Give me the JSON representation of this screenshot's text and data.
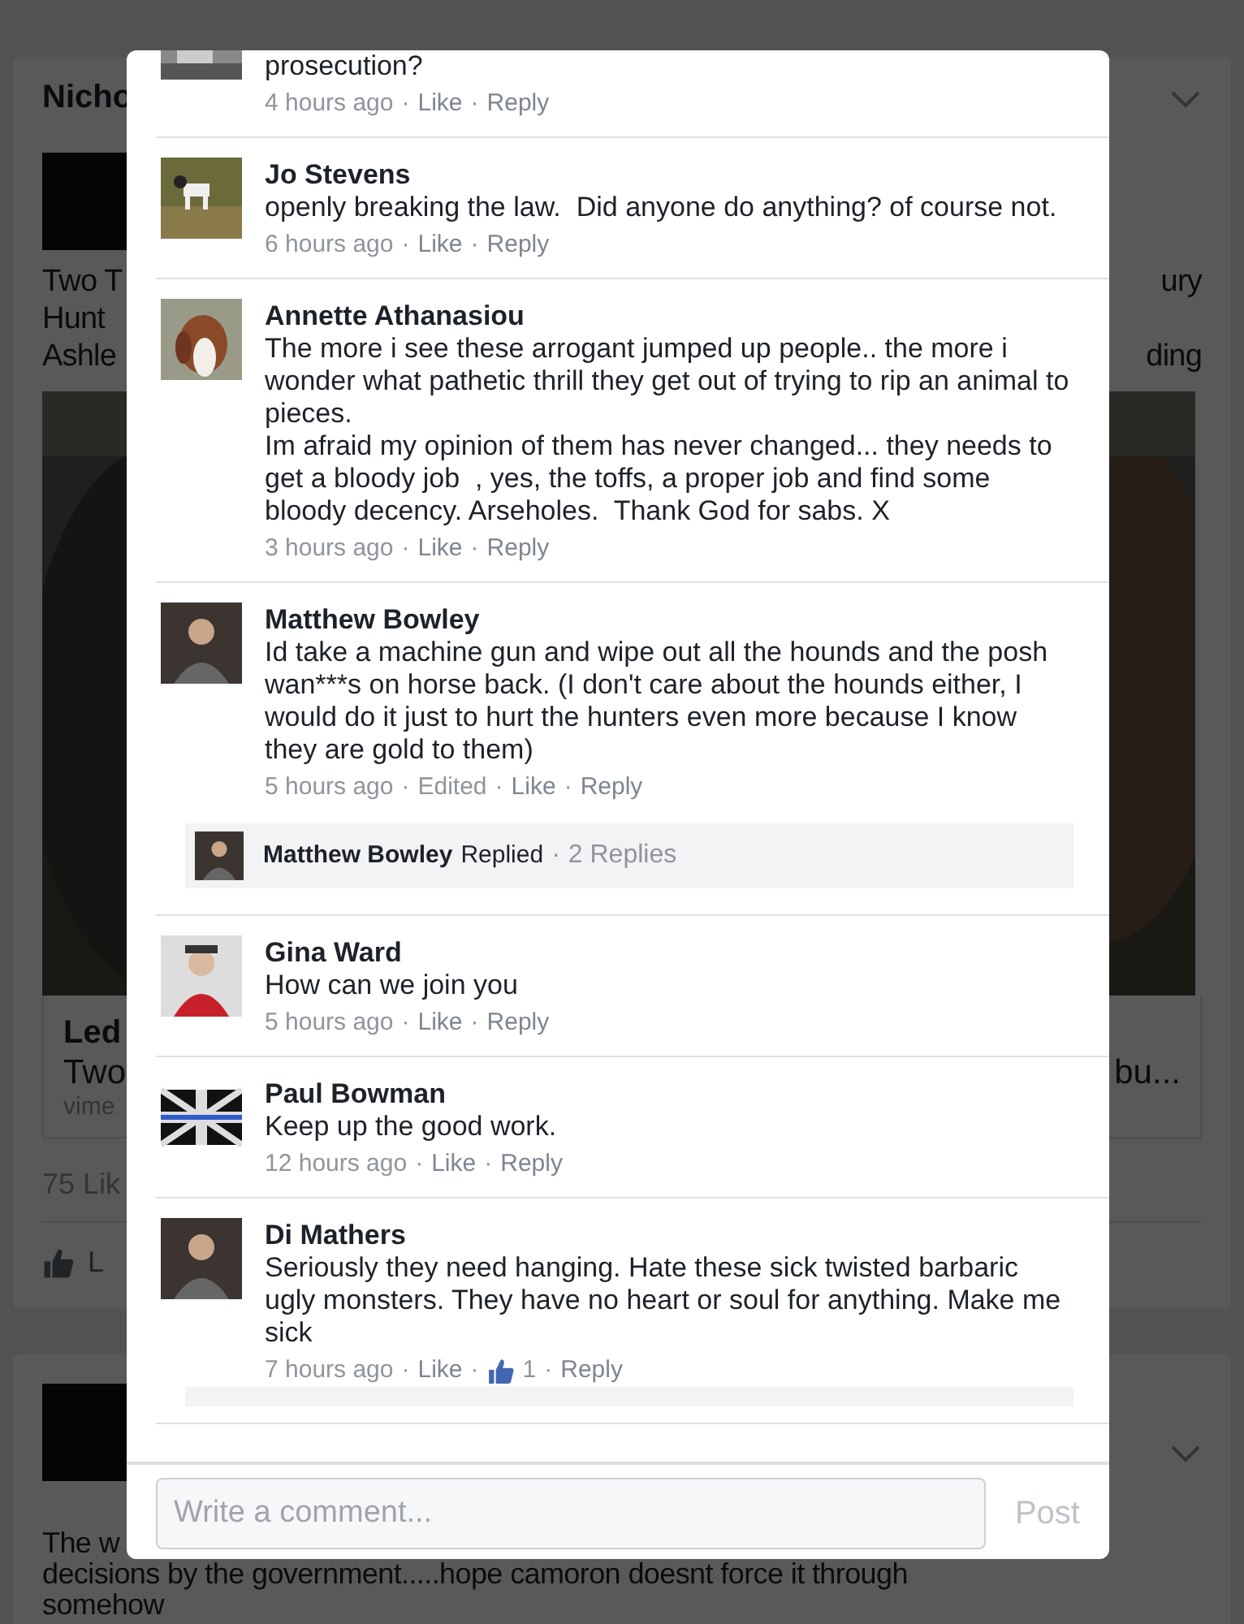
{
  "feed": {
    "post1": {
      "author": "Nicho",
      "title_rows": [
        {
          "left": "Two T",
          "right": "ury"
        },
        {
          "left": "Hunt"
        },
        {
          "left": "Ashle",
          "right": "ding"
        }
      ],
      "link": {
        "title": "Led",
        "desc_left": "Two",
        "desc_right": "bu...",
        "source": "vime"
      },
      "likes": "75 Lik",
      "action": "L"
    },
    "post2": {
      "text_left": "The w",
      "text_lines": [
        "decisions by the government.....hope camoron doesnt force it through",
        "somehow"
      ]
    }
  },
  "separator": "·",
  "comments": [
    {
      "text": [
        "prosecution?"
      ],
      "meta": [
        {
          "kind": "time",
          "text": "4 hours ago"
        },
        {
          "kind": "link",
          "text": "Like"
        },
        {
          "kind": "link",
          "text": "Reply"
        }
      ]
    },
    {
      "name": "Jo Stevens",
      "text": [
        "openly breaking the law.  Did anyone do anything? of course not."
      ],
      "meta": [
        {
          "kind": "time",
          "text": "6 hours ago"
        },
        {
          "kind": "link",
          "text": "Like"
        },
        {
          "kind": "link",
          "text": "Reply"
        }
      ]
    },
    {
      "name": "Annette Athanasiou",
      "text": [
        "The more i see these arrogant jumped up people.. the more i wonder what pathetic thrill they get out of trying to rip an animal to pieces.",
        "Im afraid my opinion of them has never changed... they needs to get a bloody job  , yes, the toffs, a proper job and find some bloody decency. Arseholes.  Thank God for sabs. X"
      ],
      "meta": [
        {
          "kind": "time",
          "text": "3 hours ago"
        },
        {
          "kind": "link",
          "text": "Like"
        },
        {
          "kind": "link",
          "text": "Reply"
        }
      ]
    },
    {
      "name": "Matthew Bowley",
      "text": [
        "Id take a machine gun and wipe out all the hounds and the posh wan***s on horse back. (I don't care about the hounds either, I would do it just to hurt the hunters even more because I know they are gold to them)"
      ],
      "meta": [
        {
          "kind": "time",
          "text": "5 hours ago"
        },
        {
          "kind": "label",
          "text": "Edited"
        },
        {
          "kind": "link",
          "text": "Like"
        },
        {
          "kind": "link",
          "text": "Reply"
        }
      ],
      "replies": {
        "name": "Matthew Bowley",
        "verb": "Replied",
        "count": "2 Replies"
      }
    },
    {
      "name": "Gina Ward",
      "text": [
        "How can we join you"
      ],
      "meta": [
        {
          "kind": "time",
          "text": "5 hours ago"
        },
        {
          "kind": "link",
          "text": "Like"
        },
        {
          "kind": "link",
          "text": "Reply"
        }
      ]
    },
    {
      "name": "Paul Bowman",
      "text": [
        "Keep up the good work."
      ],
      "meta": [
        {
          "kind": "time",
          "text": "12 hours ago"
        },
        {
          "kind": "link",
          "text": "Like"
        },
        {
          "kind": "link",
          "text": "Reply"
        }
      ]
    },
    {
      "name": "Di Mathers",
      "text": [
        "Seriously they need hanging. Hate these sick twisted barbaric ugly monsters. They have no heart or soul for anything. Make me sick"
      ],
      "meta": [
        {
          "kind": "time",
          "text": "7 hours ago"
        },
        {
          "kind": "link",
          "text": "Like"
        },
        {
          "kind": "likes",
          "text": "1"
        },
        {
          "kind": "link",
          "text": "Reply"
        }
      ]
    }
  ],
  "composer": {
    "placeholder": "Write a comment...",
    "button": "Post"
  }
}
